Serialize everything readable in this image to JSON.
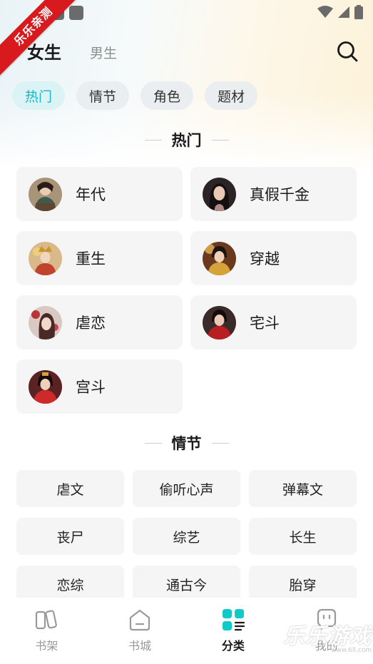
{
  "ribbon": {
    "text": "乐乐亲测"
  },
  "header": {
    "tabs": [
      {
        "label": "女生",
        "active": true
      },
      {
        "label": "男生",
        "active": false
      }
    ]
  },
  "filters": [
    {
      "label": "热门",
      "active": true
    },
    {
      "label": "情节",
      "active": false
    },
    {
      "label": "角色",
      "active": false
    },
    {
      "label": "题材",
      "active": false
    }
  ],
  "sections": {
    "hot": {
      "title": "热门",
      "items": [
        {
          "label": "年代",
          "avatar": "portrait-green-robe"
        },
        {
          "label": "真假千金",
          "avatar": "portrait-dark-hair"
        },
        {
          "label": "重生",
          "avatar": "portrait-golden-crown"
        },
        {
          "label": "穿越",
          "avatar": "portrait-golden-robe"
        },
        {
          "label": "虐恋",
          "avatar": "portrait-red-flowers"
        },
        {
          "label": "宅斗",
          "avatar": "portrait-red-dress"
        },
        {
          "label": "宫斗",
          "avatar": "portrait-red-gown"
        }
      ]
    },
    "plot": {
      "title": "情节",
      "items": [
        "虐文",
        "偷听心声",
        "弹幕文",
        "丧尸",
        "综艺",
        "长生",
        "恋综",
        "通古今",
        "胎穿"
      ]
    }
  },
  "bottom_nav": [
    {
      "label": "书架",
      "icon": "bookshelf-icon",
      "active": false
    },
    {
      "label": "书城",
      "icon": "bookstore-icon",
      "active": false
    },
    {
      "label": "分类",
      "icon": "category-icon",
      "active": true
    },
    {
      "label": "我的",
      "icon": "profile-icon",
      "active": false
    }
  ],
  "watermark": {
    "text": "乐乐游戏",
    "url": "www.6ll.com"
  },
  "colors": {
    "accent": "#19b6c6",
    "active_chip_bg": "#dcf3f5",
    "card_bg": "#f5f5f5",
    "ribbon": "#d8191e"
  }
}
